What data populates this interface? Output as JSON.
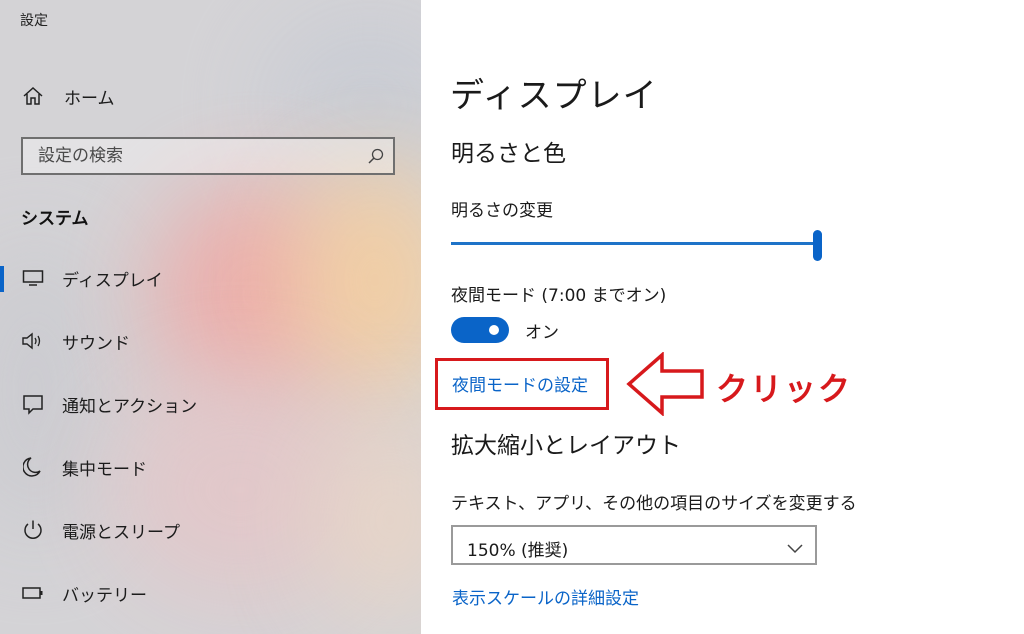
{
  "window": {
    "title": "設定"
  },
  "sidebar": {
    "home_label": "ホーム",
    "search_placeholder": "設定の検索",
    "section": "システム",
    "items": [
      {
        "label": "ディスプレイ",
        "icon": "monitor-icon",
        "active": true
      },
      {
        "label": "サウンド",
        "icon": "speaker-icon"
      },
      {
        "label": "通知とアクション",
        "icon": "notification-icon"
      },
      {
        "label": "集中モード",
        "icon": "moon-icon"
      },
      {
        "label": "電源とスリープ",
        "icon": "power-icon"
      },
      {
        "label": "バッテリー",
        "icon": "battery-icon"
      }
    ]
  },
  "main": {
    "title": "ディスプレイ",
    "brightness_section": "明るさと色",
    "brightness_label": "明るさの変更",
    "brightness_level": 1.0,
    "night_mode_label": "夜間モード (7:00 までオン)",
    "night_mode_state": "オン",
    "night_mode_settings_link": "夜間モードの設定",
    "scale_section": "拡大縮小とレイアウト",
    "text_size_label": "テキスト、アプリ、その他の項目のサイズを変更する",
    "scale_value": "150% (推奨)",
    "scale_advanced_link": "表示スケールの詳細設定"
  },
  "annotation": {
    "text": "クリック",
    "color": "#d7191c"
  },
  "colors": {
    "accent": "#0a64c8",
    "annotation": "#d7191c"
  }
}
